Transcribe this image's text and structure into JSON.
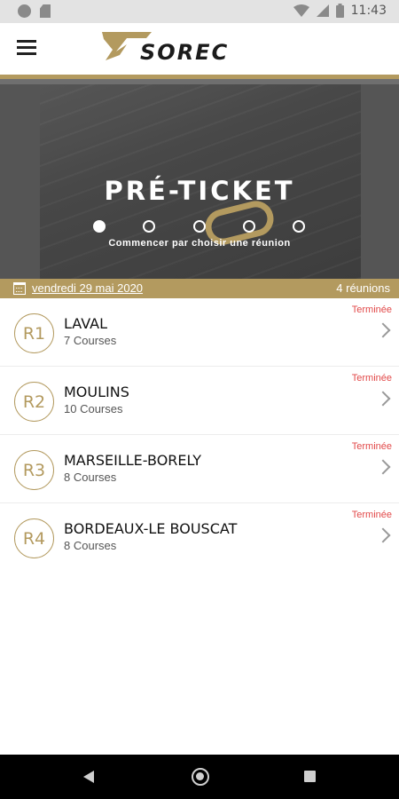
{
  "status_bar": {
    "time": "11:43",
    "icons": [
      "dot-circle-icon",
      "sd-card-icon",
      "wifi-icon",
      "signal-icon",
      "battery-icon"
    ]
  },
  "header": {
    "brand": "SOREC",
    "menu_icon": "hamburger-menu-icon"
  },
  "banner": {
    "title": "PRÉ-TICKET",
    "subtitle": "Commencer par choisir une réunion",
    "page_count": 5,
    "active_page": 1
  },
  "date_bar": {
    "date": "vendredi 29 mai 2020",
    "count": "4 réunions",
    "icon": "calendar-icon"
  },
  "meetings": [
    {
      "code": "R1",
      "name": "LAVAL",
      "courses": "7 Courses",
      "status": "Terminée"
    },
    {
      "code": "R2",
      "name": "MOULINS",
      "courses": "10 Courses",
      "status": "Terminée"
    },
    {
      "code": "R3",
      "name": "MARSEILLE-BORELY",
      "courses": "8 Courses",
      "status": "Terminée"
    },
    {
      "code": "R4",
      "name": "BORDEAUX-LE BOUSCAT",
      "courses": "8 Courses",
      "status": "Terminée"
    }
  ],
  "colors": {
    "gold": "#b39a5f",
    "status_red": "#e24a4a",
    "nav_bar": "#000000"
  }
}
